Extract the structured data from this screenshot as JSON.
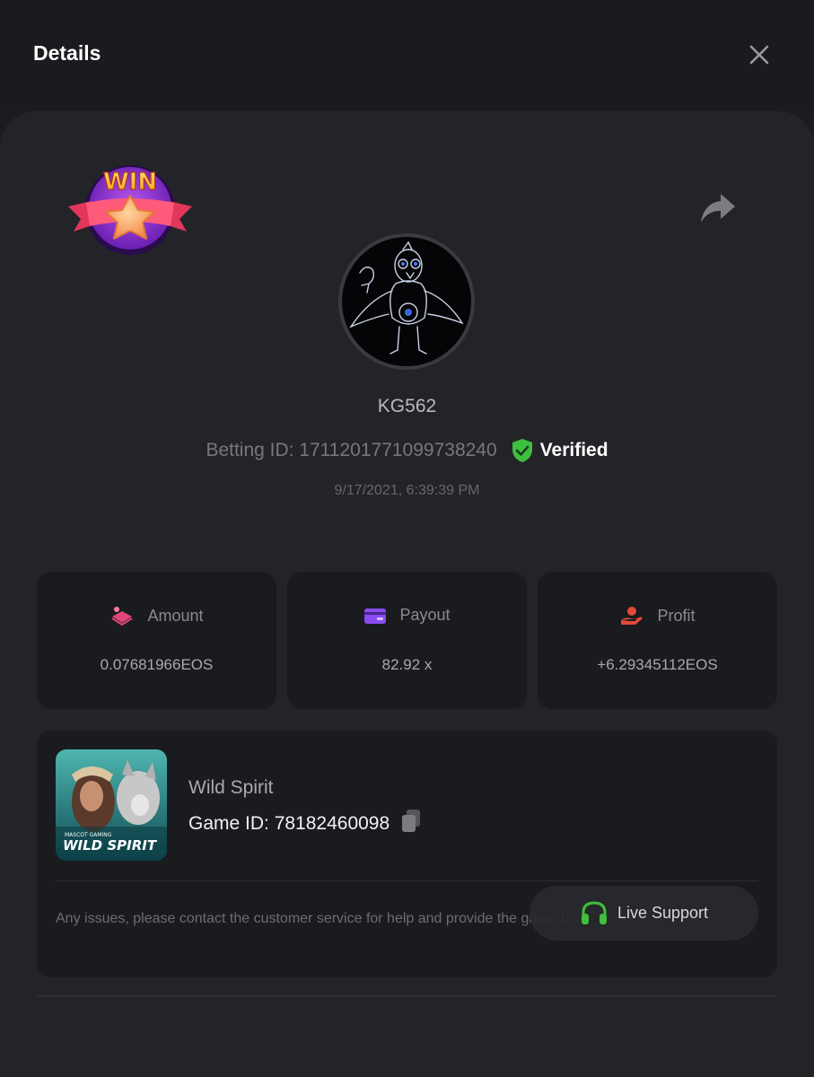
{
  "header": {
    "title": "Details"
  },
  "badge": {
    "text": "WIN"
  },
  "user": {
    "name": "KG562"
  },
  "bet": {
    "betting_id": "Betting ID: 1711201771099738240",
    "verified_label": "Verified",
    "timestamp": "9/17/2021, 6:39:39 PM"
  },
  "stats": {
    "amount": {
      "label": "Amount",
      "value": "0.07681966EOS",
      "icon": "coins-icon"
    },
    "payout": {
      "label": "Payout",
      "value": "82.92 x",
      "icon": "wallet-icon"
    },
    "profit": {
      "label": "Profit",
      "value": "+6.29345112EOS",
      "icon": "hand-money-icon"
    }
  },
  "game": {
    "name": "Wild Spirit",
    "id_text": "Game ID: 78182460098",
    "thumb_title": "WILD SPIRIT",
    "thumb_brand": "MASCOT GAMING",
    "note": "Any issues, please contact the customer service for help and provide the game ID."
  },
  "support": {
    "label": "Live Support",
    "icon": "headset-icon"
  },
  "colors": {
    "verified": "#3fbf3f",
    "amount_icon": "#e0467b",
    "payout_icon": "#8a4cf0",
    "profit_icon": "#e24a3a",
    "support_icon": "#3fbf3f"
  }
}
